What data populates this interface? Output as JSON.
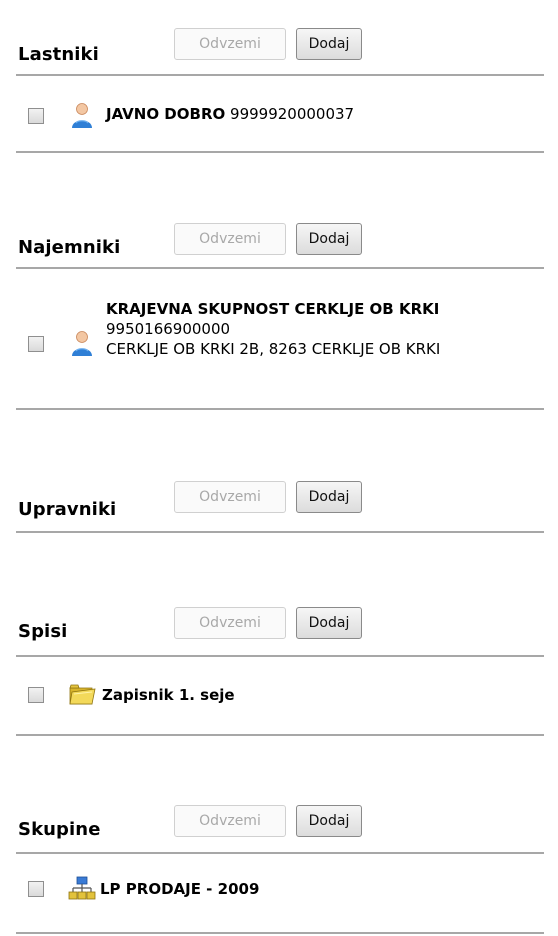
{
  "buttons": {
    "remove_label": "Odvzemi",
    "add_label": "Dodaj"
  },
  "sections": {
    "owners": {
      "title": "Lastniki",
      "items": [
        {
          "name": "JAVNO DOBRO",
          "id": "9999920000037",
          "icon": "person-icon"
        }
      ]
    },
    "tenants": {
      "title": "Najemniki",
      "items": [
        {
          "name": "KRAJEVNA SKUPNOST CERKLJE OB KRKI",
          "id": "9950166900000",
          "address": "CERKLJE OB KRKI 2B, 8263 CERKLJE OB KRKI",
          "icon": "person-icon"
        }
      ]
    },
    "managers": {
      "title": "Upravniki",
      "items": []
    },
    "files": {
      "title": "Spisi",
      "items": [
        {
          "name": "Zapisnik 1. seje",
          "icon": "folder-icon"
        }
      ]
    },
    "groups": {
      "title": "Skupine",
      "items": [
        {
          "name": "LP PRODAJE - 2009",
          "icon": "group-icon"
        }
      ]
    }
  },
  "colors": {
    "rule": "#a7a7a7",
    "disabled_text": "#a8a8a8",
    "person_blue": "#2f7fd6",
    "folder_yellow": "#f0d040"
  }
}
